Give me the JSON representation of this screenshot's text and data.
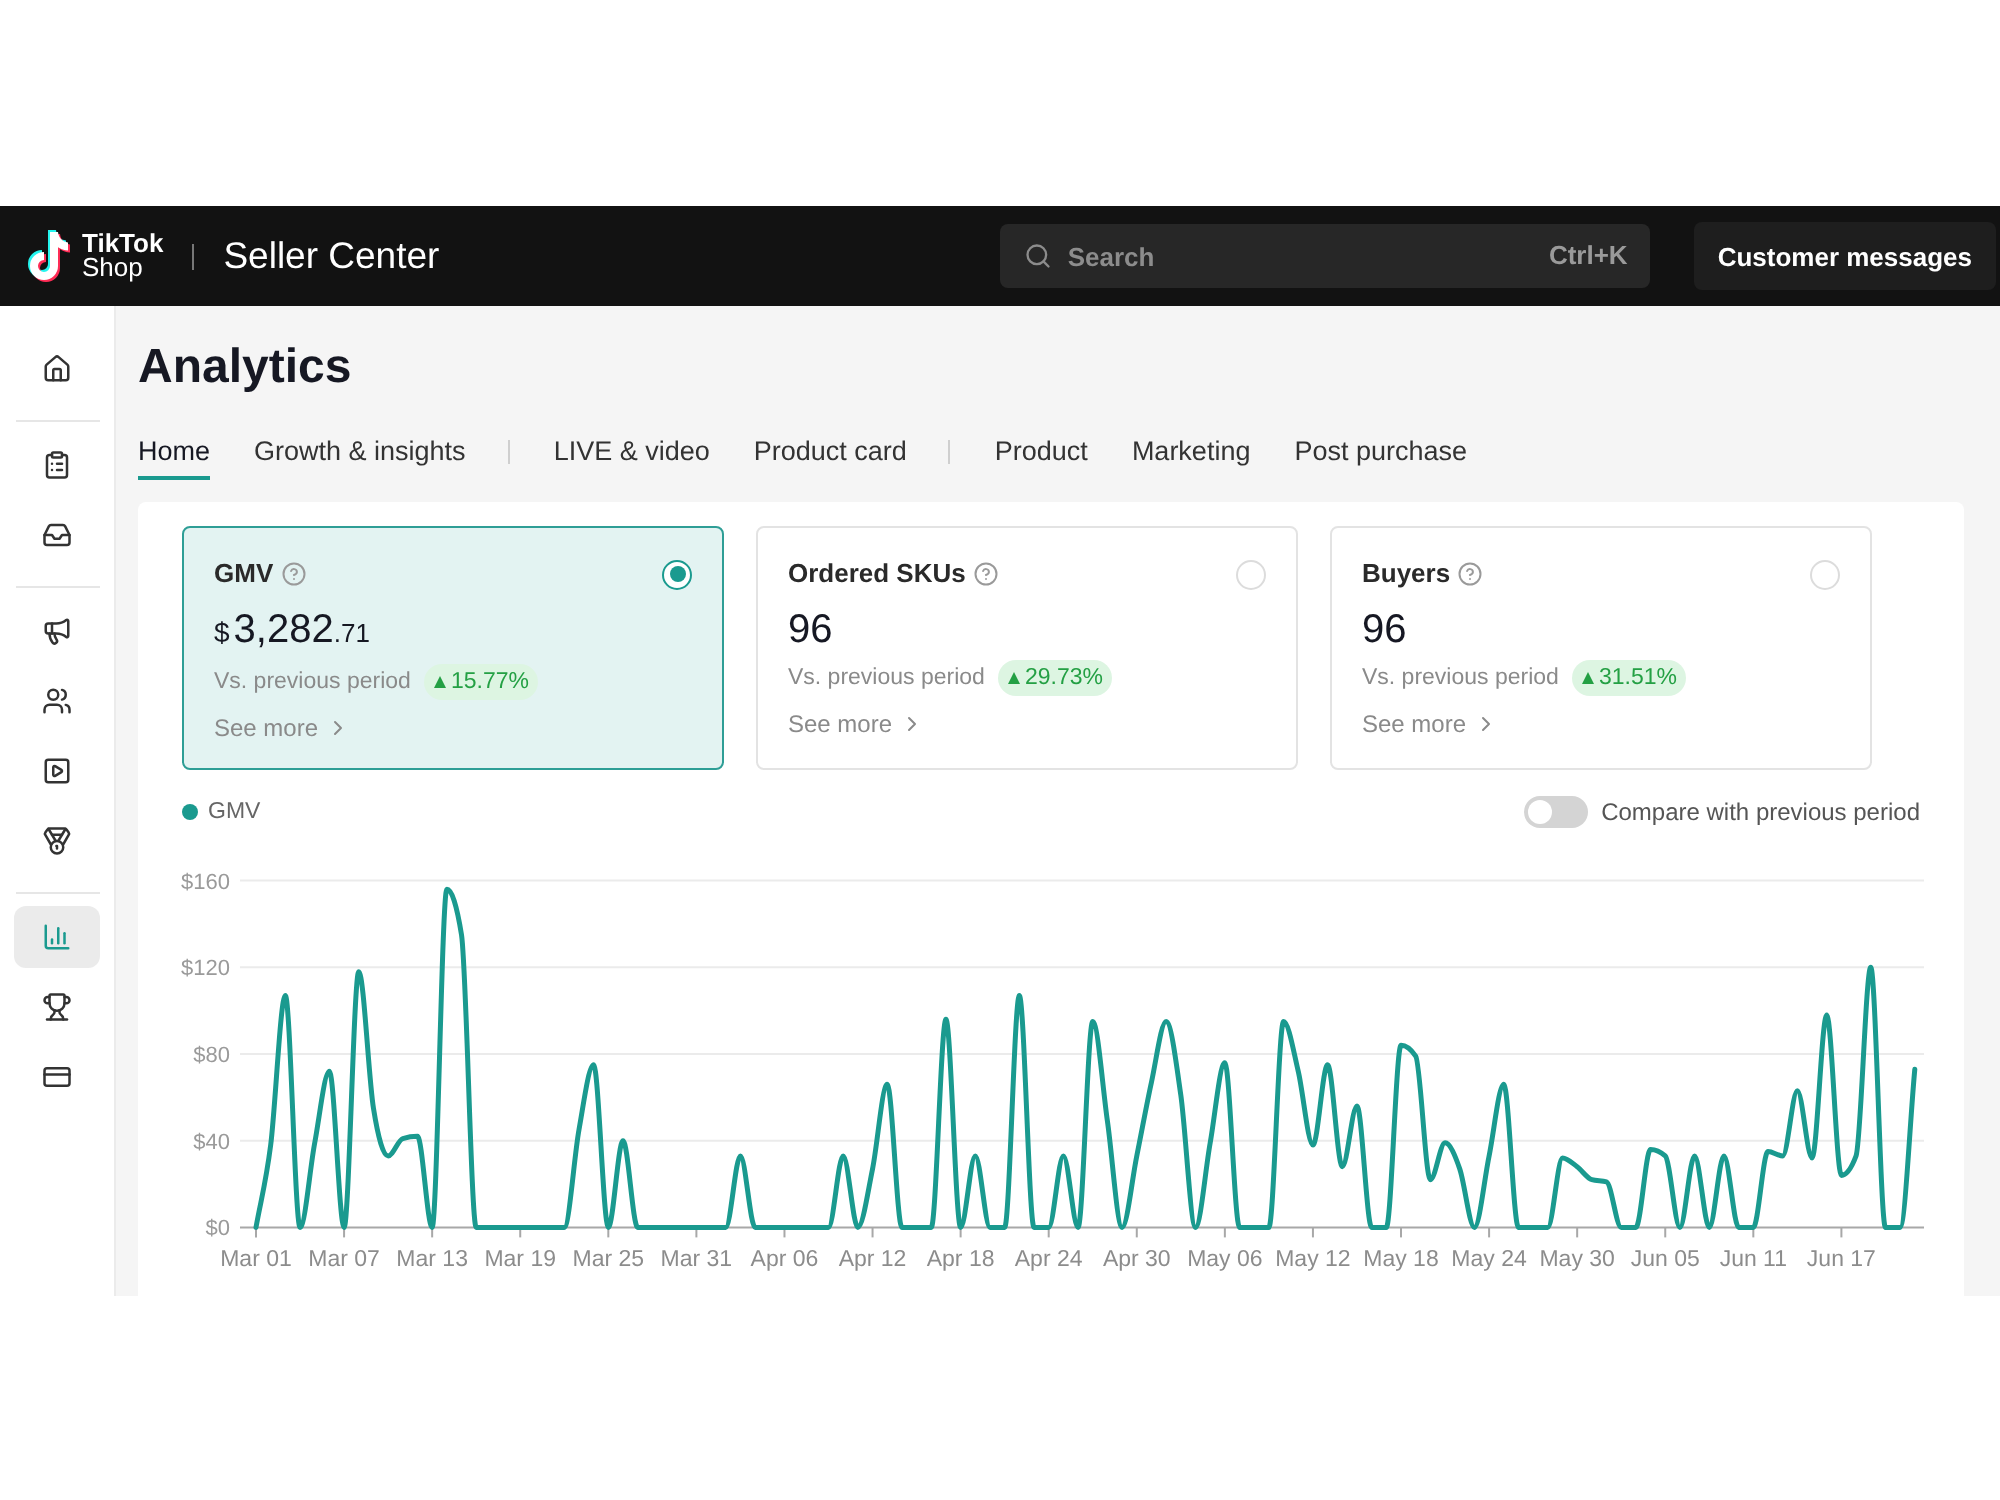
{
  "header": {
    "logo": {
      "lines": [
        "TikTok",
        "Shop"
      ]
    },
    "app_title": "Seller Center",
    "search": {
      "placeholder": "Search",
      "shortcut": "Ctrl+K"
    },
    "customer_messages_button": "Customer messages"
  },
  "sidebar": {
    "groups": [
      {
        "items": [
          {
            "selected": false
          }
        ]
      },
      {
        "items": [
          {
            "selected": false
          },
          {
            "selected": false
          }
        ]
      },
      {
        "items": [
          {
            "selected": false
          },
          {
            "selected": false
          },
          {
            "selected": false
          },
          {
            "selected": false
          }
        ]
      },
      {
        "items": [
          {
            "selected": true
          },
          {
            "selected": false
          },
          {
            "selected": false
          }
        ]
      }
    ]
  },
  "page_title": "Analytics",
  "tabs": {
    "groups": [
      {
        "items": [
          {
            "label": "Home",
            "selected": true
          },
          {
            "label": "Growth & insights",
            "selected": false
          }
        ]
      },
      {
        "items": [
          {
            "label": "LIVE & video",
            "selected": false
          },
          {
            "label": "Product card",
            "selected": false
          }
        ]
      },
      {
        "items": [
          {
            "label": "Product",
            "selected": false
          },
          {
            "label": "Marketing",
            "selected": false
          },
          {
            "label": "Post purchase",
            "selected": false
          }
        ]
      }
    ]
  },
  "metrics": [
    {
      "label": "GMV",
      "selected": true,
      "value": {
        "unit": "$",
        "main": "3,282",
        "decimals": ".71"
      },
      "comparison_label": "Vs. previous period",
      "change": "15.77%",
      "link": "See more"
    },
    {
      "label": "Ordered SKUs",
      "selected": false,
      "value": {
        "main": "96"
      },
      "comparison_label": "Vs. previous period",
      "change": "29.73%",
      "link": "See more"
    },
    {
      "label": "Buyers",
      "selected": false,
      "value": {
        "main": "96"
      },
      "comparison_label": "Vs. previous period",
      "change": "31.51%",
      "link": "See more"
    }
  ],
  "chart": {
    "compare_toggle": {
      "label": "Compare with previous period",
      "on": false
    },
    "chart_data": {
      "type": "line",
      "grid": true,
      "categories": [
        "Mar 01",
        null,
        null,
        null,
        null,
        null,
        "Mar 07",
        null,
        null,
        null,
        null,
        null,
        "Mar 13",
        null,
        null,
        null,
        null,
        null,
        "Mar 19",
        null,
        null,
        null,
        null,
        null,
        "Mar 25",
        null,
        null,
        null,
        null,
        null,
        "Mar 31",
        null,
        null,
        null,
        null,
        null,
        "Apr 06",
        null,
        null,
        null,
        null,
        null,
        "Apr 12",
        null,
        null,
        null,
        null,
        null,
        "Apr 18",
        null,
        null,
        null,
        null,
        null,
        "Apr 24",
        null,
        null,
        null,
        null,
        null,
        "Apr 30",
        null,
        null,
        null,
        null,
        null,
        "May 06",
        null,
        null,
        null,
        null,
        null,
        "May 12",
        null,
        null,
        null,
        null,
        null,
        "May 18",
        null,
        null,
        null,
        null,
        null,
        "May 24",
        null,
        null,
        null,
        null,
        null,
        "May 30",
        null,
        null,
        null,
        null,
        null,
        "Jun 05",
        null,
        null,
        null,
        null,
        null,
        "Jun 11",
        null,
        null,
        null,
        null,
        null,
        "Jun 17",
        null,
        null,
        null,
        null,
        null
      ],
      "series": [
        {
          "name": "GMV",
          "color": "#1a9a8f",
          "values": [
            0,
            38,
            107,
            0,
            39,
            72,
            0,
            118,
            55,
            33,
            41,
            42,
            0,
            156,
            135,
            0,
            0,
            0,
            0,
            0,
            0,
            0,
            45,
            75,
            0,
            40,
            0,
            0,
            0,
            0,
            0,
            0,
            0,
            33,
            0,
            0,
            0,
            0,
            0,
            0,
            33,
            0,
            27,
            66,
            0,
            0,
            0,
            96,
            0,
            33,
            0,
            0,
            107,
            0,
            0,
            33,
            0,
            95,
            49,
            0,
            33,
            67,
            95,
            61,
            0,
            39,
            76,
            0,
            0,
            0,
            95,
            72,
            38,
            75,
            28,
            56,
            0,
            0,
            84,
            79,
            22,
            39,
            27,
            0,
            33,
            66,
            0,
            0,
            0,
            32,
            28,
            22,
            21,
            0,
            0,
            36,
            33,
            0,
            33,
            0,
            33,
            0,
            0,
            35,
            33,
            63,
            32,
            98,
            24,
            33,
            120,
            0,
            0,
            73
          ]
        }
      ],
      "ylim": [
        0,
        160
      ],
      "yticks": [
        {
          "value": 0,
          "label": "$0"
        },
        {
          "value": 40,
          "label": "$40"
        },
        {
          "value": 80,
          "label": "$80"
        },
        {
          "value": 120,
          "label": "$120"
        },
        {
          "value": 160,
          "label": "$160"
        }
      ]
    }
  }
}
